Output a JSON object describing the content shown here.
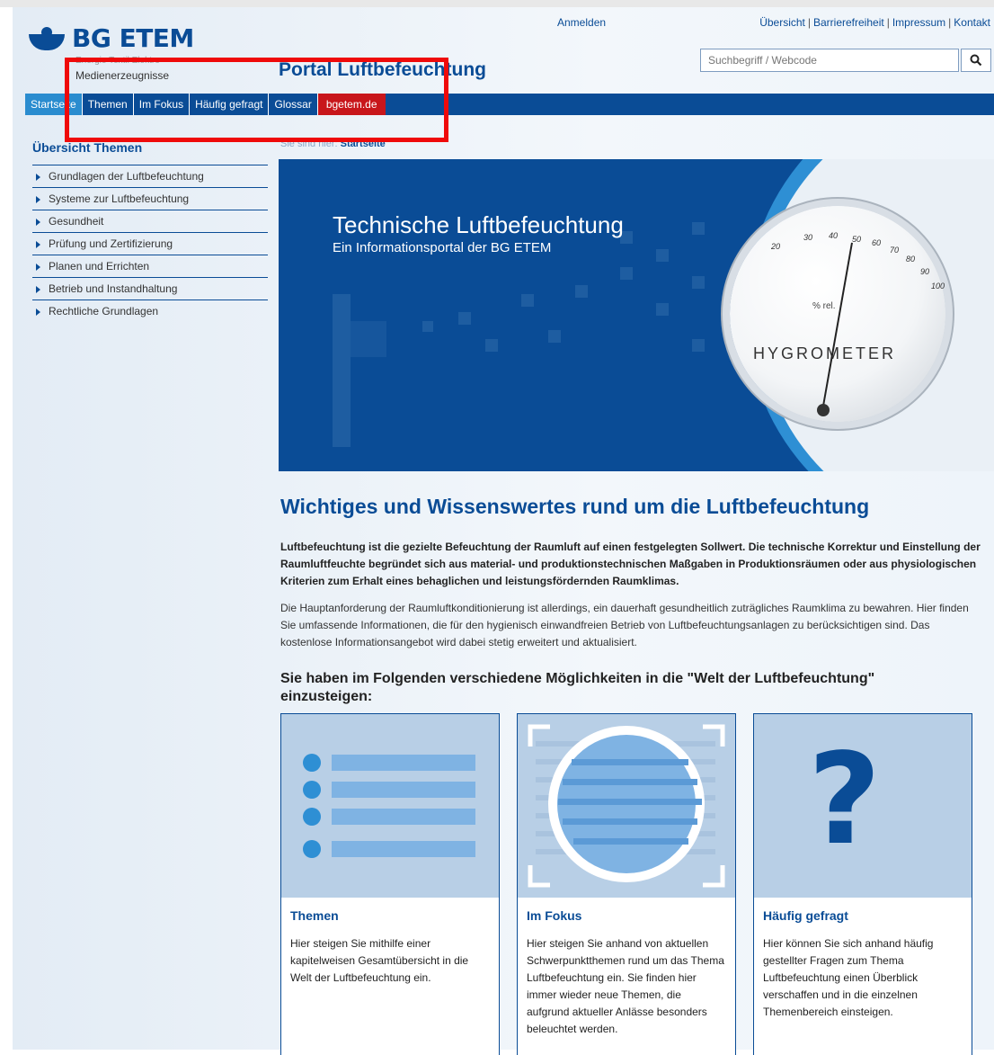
{
  "header": {
    "logo_text": "BG ETEM",
    "logo_sub1": "Energie Textil Elektro",
    "logo_sub2": "Medienerzeugnisse",
    "login_label": "Anmelden",
    "meta_links": [
      "Übersicht",
      "Barrierefreiheit",
      "Impressum",
      "Kontakt"
    ],
    "search_placeholder": "Suchbegriff / Webcode",
    "portal_title": "Portal Luftbefeuchtung"
  },
  "nav": {
    "items": [
      "Startseite",
      "Themen",
      "Im Fokus",
      "Häufig gefragt",
      "Glossar",
      "bgetem.de"
    ]
  },
  "breadcrumb": {
    "prefix": "Sie sind hier:",
    "current": "Startseite"
  },
  "sidebar": {
    "heading": "Übersicht Themen",
    "items": [
      "Grundlagen der Luftbefeuchtung",
      "Systeme zur Luftbefeuchtung",
      "Gesundheit",
      "Prüfung und Zertifizierung",
      "Planen und Errichten",
      "Betrieb und Instandhaltung",
      "Rechtliche Grundlagen"
    ]
  },
  "hero": {
    "title": "Technische Luftbefeuchtung",
    "subtitle": "Ein Informationsportal der BG ETEM",
    "hygrometer_label": "HYGROMETER",
    "hygrometer_unit": "% rel.",
    "scale": [
      "20",
      "30",
      "40",
      "50",
      "60",
      "70",
      "80",
      "90",
      "100"
    ]
  },
  "main": {
    "heading": "Wichtiges und Wissenswertes rund um die Luftbefeuchtung",
    "intro_bold": "Luftbefeuchtung ist die gezielte Befeuchtung der Raumluft auf einen festgelegten Sollwert. Die technische Korrektur und Einstellung der Raumluftfeuchte begründet sich aus material- und produktionstechnischen Maßgaben in Produktionsräumen oder aus physiologischen Kriterien zum Erhalt eines behaglichen und leistungsfördernden Raumklimas.",
    "intro": "Die Hauptanforderung der Raumluftkonditionierung ist allerdings, ein dauerhaft gesundheitlich zuträgliches Raumklima zu bewahren. Hier finden Sie umfassende Informationen, die für den hygienisch einwandfreien Betrieb von Luftbefeuchtungsanlagen zu berücksichtigen sind. Das kostenlose Informationsangebot wird dabei stetig erweitert und aktualisiert.",
    "subheading": "Sie haben im Folgenden verschiedene Möglichkeiten in die \"Welt der Luftbefeuchtung\" einzusteigen:",
    "cards": [
      {
        "title": "Themen",
        "text": "Hier steigen Sie mithilfe einer kapitelweisen Gesamtübersicht in die Welt der Luftbefeuchtung ein."
      },
      {
        "title": "Im Fokus",
        "text": "Hier steigen Sie anhand von aktuellen Schwerpunktthemen rund um das Thema Luftbefeuchtung ein. Sie finden hier immer wieder neue Themen, die aufgrund aktueller Anlässe besonders beleuchtet werden."
      },
      {
        "title": "Häufig gefragt",
        "text": "Hier können Sie sich anhand häufig gestellter Fragen zum Thema Luftbefeuchtung einen Überblick verschaffen und in die einzelnen Themenbereich einsteigen."
      }
    ],
    "question_mark": "?"
  },
  "colors": {
    "brand": "#0a4c96",
    "accent": "#2e8fd4",
    "highlight": "#ef0a0a",
    "bgetem": "#c8161b"
  }
}
